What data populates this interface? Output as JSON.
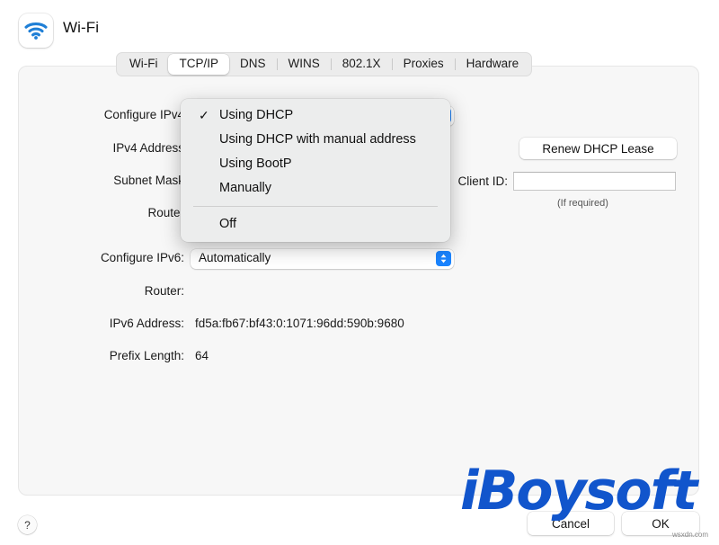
{
  "header": {
    "title": "Wi-Fi",
    "icon": "wifi-icon"
  },
  "tabs": [
    {
      "label": "Wi-Fi",
      "selected": false
    },
    {
      "label": "TCP/IP",
      "selected": true
    },
    {
      "label": "DNS",
      "selected": false
    },
    {
      "label": "WINS",
      "selected": false
    },
    {
      "label": "802.1X",
      "selected": false
    },
    {
      "label": "Proxies",
      "selected": false
    },
    {
      "label": "Hardware",
      "selected": false
    }
  ],
  "form": {
    "configure_ipv4_label": "Configure IPv4",
    "configure_ipv4_value": "Using DHCP",
    "ipv4_address_label": "IPv4 Address",
    "ipv4_address_value": "",
    "subnet_mask_label": "Subnet Mask",
    "subnet_mask_value": "",
    "router_label": "Router",
    "router_value": "",
    "renew_dhcp_lease_label": "Renew DHCP Lease",
    "client_id_label": "Client ID:",
    "client_id_value": "",
    "client_id_hint": "(If required)",
    "configure_ipv6_label": "Configure IPv6:",
    "configure_ipv6_value": "Automatically",
    "ipv6_router_label": "Router:",
    "ipv6_router_value": "",
    "ipv6_address_label": "IPv6 Address:",
    "ipv6_address_value": "fd5a:fb67:bf43:0:1071:96dd:590b:9680",
    "prefix_length_label": "Prefix Length:",
    "prefix_length_value": "64"
  },
  "menu": {
    "items": [
      {
        "label": "Using DHCP",
        "checked": true
      },
      {
        "label": "Using DHCP with manual address",
        "checked": false
      },
      {
        "label": "Using BootP",
        "checked": false
      },
      {
        "label": "Manually",
        "checked": false
      },
      {
        "label": "Off",
        "checked": false
      }
    ],
    "checkmark": "✓"
  },
  "bottom": {
    "help_label": "?",
    "cancel_label": "Cancel",
    "ok_label": "OK"
  },
  "watermark": {
    "brand": "iBoysoft",
    "url": "wsxdn.com"
  },
  "colors": {
    "accent": "#1a84ff",
    "panel_bg": "#f7f7f7",
    "menu_bg": "#eceded",
    "watermark_blue": "#1155cc"
  }
}
